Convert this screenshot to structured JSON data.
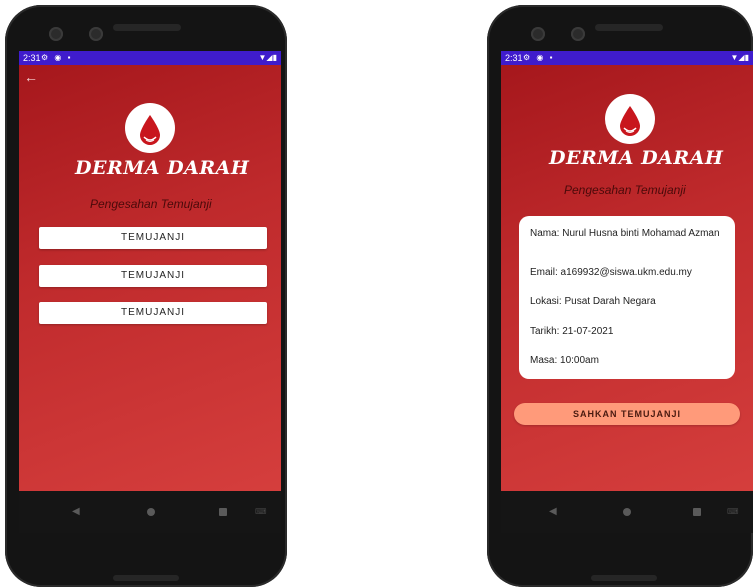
{
  "status_bar": {
    "time": "2:31",
    "left_icons": "⚙ ◉ ▪",
    "right_icons": "▼◢▮"
  },
  "app": {
    "title": "DERMA DARAH",
    "subtitle": "Pengesahan Temujanji"
  },
  "left_screen": {
    "back_icon": "←",
    "buttons": [
      "TEMUJANJI",
      "TEMUJANJI",
      "TEMUJANJI"
    ]
  },
  "right_screen": {
    "details": {
      "name": "Nama: Nurul Husna binti Mohamad Azman",
      "email": "Email: a169932@siswa.ukm.edu.my",
      "location": "Lokasi: Pusat Darah Negara",
      "date": "Tarikh: 21-07-2021",
      "time": "Masa: 10:00am"
    },
    "confirm_label": "SAHKAN TEMUJANJI"
  },
  "nav": {
    "back": "◀",
    "keyboard": "⌨"
  },
  "colors": {
    "statusbar": "#3f1ccc",
    "gradient_start": "#a4161b",
    "gradient_end": "#d8413f",
    "confirm_button": "#ff9a7a",
    "drop": "#c8161d"
  },
  "icons": {
    "logo": "blood-drop-icon",
    "back": "arrow-left-icon"
  }
}
